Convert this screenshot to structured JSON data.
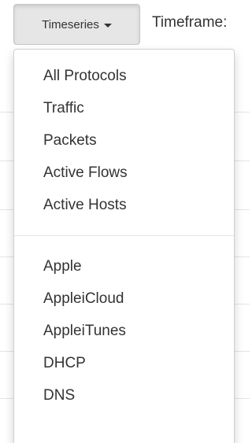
{
  "toolbar": {
    "timeseries_label": "Timeseries",
    "timeframe_label": "Timeframe:"
  },
  "menu": {
    "group1": [
      {
        "label": "All Protocols"
      },
      {
        "label": "Traffic"
      },
      {
        "label": "Packets"
      },
      {
        "label": "Active Flows"
      },
      {
        "label": "Active Hosts"
      }
    ],
    "group2": [
      {
        "label": "Apple"
      },
      {
        "label": "AppleiCloud"
      },
      {
        "label": "AppleiTunes"
      },
      {
        "label": "DHCP"
      },
      {
        "label": "DNS"
      }
    ]
  },
  "icons": {
    "caret": "chevron-down-icon"
  }
}
